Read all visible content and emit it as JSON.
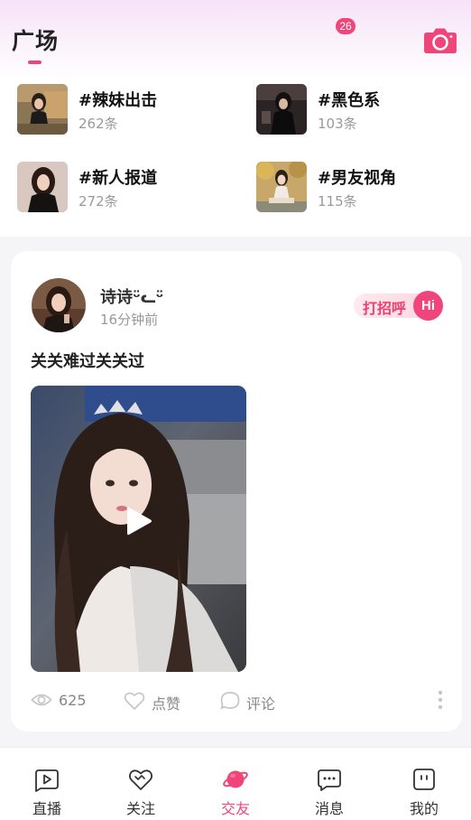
{
  "header": {
    "title": "广场",
    "accent_color": "#f0457a",
    "camera_icon": "camera-icon"
  },
  "topics": [
    {
      "name": "#辣妹出击",
      "count": "262条"
    },
    {
      "name": "#黑色系",
      "count": "103条"
    },
    {
      "name": "#新人报道",
      "count": "272条"
    },
    {
      "name": "#男友视角",
      "count": "115条"
    }
  ],
  "post": {
    "username": "诗诗ᵕ̈ᓚᵕ̈",
    "time": "16分钟前",
    "greet_label": "打招呼",
    "greet_badge": "Hi",
    "text": "关关难过关关过",
    "views": "625",
    "like_label": "点赞",
    "comment_label": "评论"
  },
  "tabbar": {
    "items": [
      {
        "label": "直播",
        "icon": "live-icon"
      },
      {
        "label": "关注",
        "icon": "heart-icon"
      },
      {
        "label": "交友",
        "icon": "planet-icon",
        "active": true
      },
      {
        "label": "消息",
        "icon": "chat-icon"
      },
      {
        "label": "我的",
        "icon": "profile-icon"
      }
    ],
    "message_badge": "26"
  }
}
